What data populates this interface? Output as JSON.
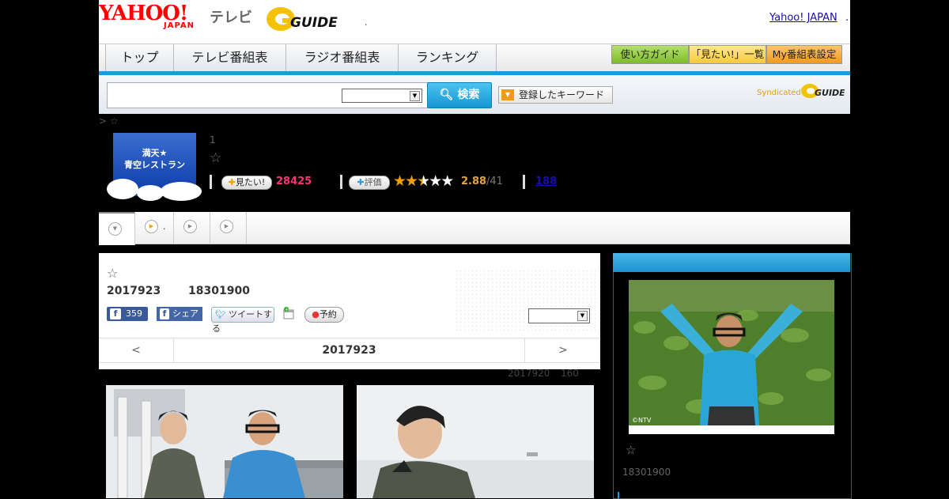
{
  "header": {
    "yahoo_logo": "YAHOO!",
    "yahoo_sub": "JAPAN",
    "tv_label": "テレビ",
    "gguide_logo": "GUIDE",
    "header_dot": ".",
    "yahoo_japan_link": "Yahoo! JAPAN",
    "link_dot": "."
  },
  "nav": {
    "tabs": [
      {
        "label": "トップ"
      },
      {
        "label": "テレビ番組表"
      },
      {
        "label": "ラジオ番組表"
      },
      {
        "label": "ランキング"
      }
    ],
    "guide_buttons": [
      {
        "label": "使い方ガイド"
      },
      {
        "label": "「見たい!」一覧"
      },
      {
        "label": "My番組表設定"
      }
    ]
  },
  "search": {
    "input_value": "",
    "select_value": "",
    "button_label": "検索",
    "keyword_button": "登録したキーワード",
    "syndicated_label": "Syndicated",
    "syndicated_logo": "GUIDE"
  },
  "breadcrumb": "> ☆",
  "program": {
    "thumb_title_1": "満天★",
    "thumb_title_2": "青空レストラン",
    "number": "1",
    "star": "☆",
    "mitai_label": "見たい!",
    "mitai_count": "28425",
    "hyoka_label": "評価",
    "rating_value": 2.88,
    "rating": "2.88",
    "rating_denominator": "/41",
    "review_link": "188"
  },
  "tabrow": {
    "tab2_dot": "."
  },
  "card": {
    "star": "☆",
    "date": "2017923",
    "time": "18301900",
    "fb_count": "359",
    "share_label": "シェア",
    "tweet_label": "ツイートする",
    "reserve_label": "予約",
    "select_value": "",
    "pager_prev": "<",
    "pager_date": "2017923",
    "pager_next": ">"
  },
  "note": {
    "date": "2017920",
    "count": "160"
  },
  "sidebar": {
    "copyright": "©NTV",
    "star": "☆",
    "time": "18301900"
  },
  "colors": {
    "accent_blue": "#1e9ad8",
    "mitai_pink": "#ff3377",
    "rating_orange": "#e8a33a",
    "guide_green": "#8ec63f",
    "guide_yellow": "#ffd75a",
    "guide_orange": "#f5a623"
  }
}
